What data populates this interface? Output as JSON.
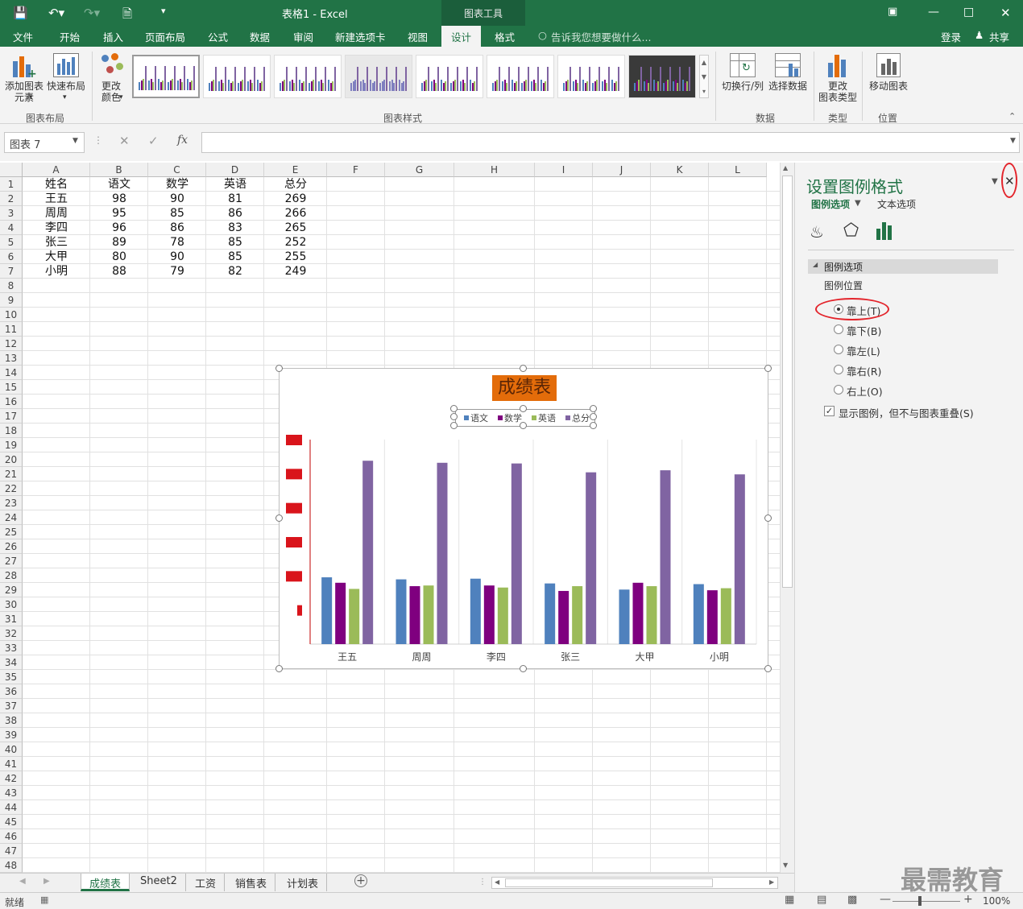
{
  "window": {
    "title": "表格1 - Excel",
    "context_tab": "图表工具"
  },
  "tabs": [
    "文件",
    "开始",
    "插入",
    "页面布局",
    "公式",
    "数据",
    "审阅",
    "新建选项卡",
    "视图",
    "设计",
    "格式"
  ],
  "active_tab": "设计",
  "tell_me": "告诉我您想要做什么...",
  "account": {
    "login": "登录",
    "share": "共享"
  },
  "ribbon": {
    "add_element": "添加图表\n元素",
    "quick_layout": "快速布局",
    "change_colors": "更改\n颜色",
    "group_layout": "图表布局",
    "group_styles": "图表样式",
    "switch_rowcol": "切换行/列",
    "select_data": "选择数据",
    "group_data": "数据",
    "change_type": "更改\n图表类型",
    "group_type": "类型",
    "move_chart": "移动图表",
    "group_location": "位置"
  },
  "namebox": "图表 7",
  "columns": [
    "A",
    "B",
    "C",
    "D",
    "E",
    "F",
    "G",
    "H",
    "I",
    "J",
    "K",
    "L"
  ],
  "sheet": {
    "header": [
      "姓名",
      "语文",
      "数学",
      "英语",
      "总分"
    ],
    "rows": [
      [
        "王五",
        "98",
        "90",
        "81",
        "269"
      ],
      [
        "周周",
        "95",
        "85",
        "86",
        "266"
      ],
      [
        "李四",
        "96",
        "86",
        "83",
        "265"
      ],
      [
        "张三",
        "89",
        "78",
        "85",
        "252"
      ],
      [
        "大甲",
        "80",
        "90",
        "85",
        "255"
      ],
      [
        "小明",
        "88",
        "79",
        "82",
        "249"
      ]
    ]
  },
  "chart_data": {
    "type": "bar",
    "title": "成绩表",
    "categories": [
      "王五",
      "周周",
      "李四",
      "张三",
      "大甲",
      "小明"
    ],
    "series": [
      {
        "name": "语文",
        "values": [
          98,
          95,
          96,
          89,
          80,
          88
        ],
        "color": "#4f81bd"
      },
      {
        "name": "数学",
        "values": [
          90,
          85,
          86,
          78,
          90,
          79
        ],
        "color": "#7f007f"
      },
      {
        "name": "英语",
        "values": [
          81,
          86,
          83,
          85,
          85,
          82
        ],
        "color": "#9bbb59"
      },
      {
        "name": "总分",
        "values": [
          269,
          266,
          265,
          252,
          255,
          249
        ],
        "color": "#8064a2"
      }
    ],
    "ylim": [
      0,
      300
    ],
    "legend": "top",
    "grid": "vertical"
  },
  "sheet_tabs": [
    "成绩表",
    "Sheet2",
    "工资",
    "销售表",
    "计划表"
  ],
  "status": {
    "ready": "就绪",
    "zoom": "100%"
  },
  "panel": {
    "title": "设置图例格式",
    "tab_legend": "图例选项",
    "tab_text": "文本选项",
    "section": "图例选项",
    "position_label": "图例位置",
    "options": [
      "靠上(T)",
      "靠下(B)",
      "靠左(L)",
      "靠右(R)",
      "右上(O)"
    ],
    "selected": "靠上(T)",
    "show_legend": "显示图例，但不与图表重叠(S)"
  },
  "watermark": "最需教育",
  "colors": {
    "excel_green": "#217346",
    "title_fill": "#e36c0a",
    "highlight": "#e3242b"
  }
}
